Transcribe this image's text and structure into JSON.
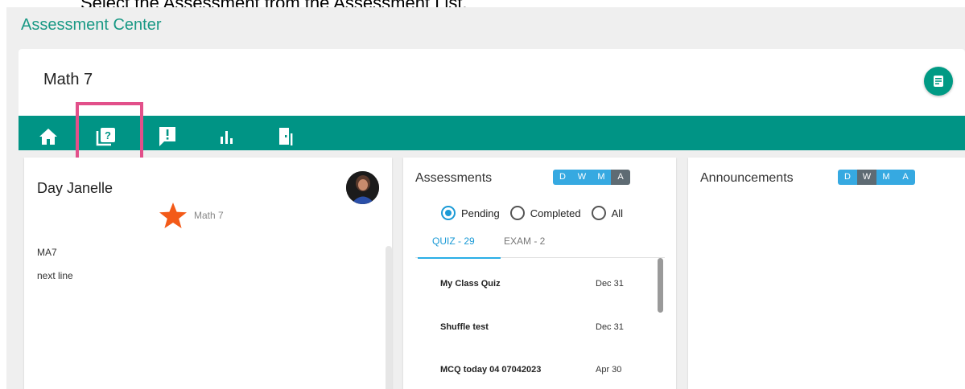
{
  "caption": "Select the Assessment from the Assessment List.",
  "app": {
    "title": "Assessment Center"
  },
  "course": {
    "title": "Math 7",
    "menu_icon": "list-icon"
  },
  "nav": {
    "items": [
      {
        "icon": "home-icon"
      },
      {
        "icon": "assessment-library-icon"
      },
      {
        "icon": "alert-message-icon"
      },
      {
        "icon": "bar-chart-icon"
      },
      {
        "icon": "door-exit-icon"
      }
    ],
    "accent": "#009485",
    "highlight_color": "#e2508a"
  },
  "profile": {
    "name": "Day Janelle",
    "starred_course": "Math 7",
    "code": "MA7",
    "note": "next line"
  },
  "assessments": {
    "title": "Assessments",
    "ranges": [
      "D",
      "W",
      "M",
      "A"
    ],
    "active_range": "A",
    "filters": [
      {
        "label": "Pending",
        "selected": true
      },
      {
        "label": "Completed",
        "selected": false
      },
      {
        "label": "All",
        "selected": false
      }
    ],
    "tabs": [
      {
        "label": "QUIZ - 29",
        "active": true
      },
      {
        "label": "EXAM - 2",
        "active": false
      }
    ],
    "items": [
      {
        "name": "My Class Quiz",
        "date": "Dec 31"
      },
      {
        "name": "Shuffle test",
        "date": "Dec 31"
      },
      {
        "name": "MCQ today 04 07042023",
        "date": "Apr 30"
      }
    ]
  },
  "announcements": {
    "title": "Announcements",
    "ranges": [
      "D",
      "W",
      "M",
      "A"
    ],
    "active_range": "W"
  }
}
